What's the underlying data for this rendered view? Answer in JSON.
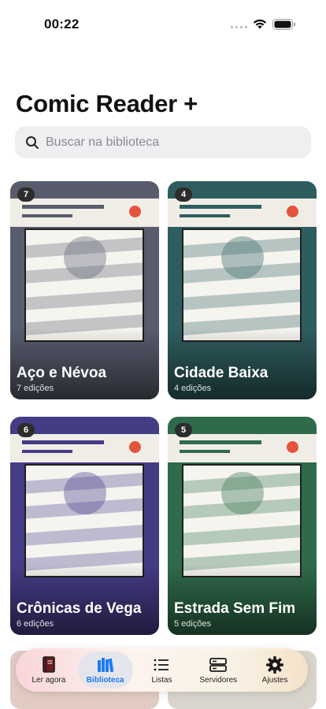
{
  "status_bar": {
    "time": "00:22"
  },
  "app": {
    "title": "Comic Reader +"
  },
  "search": {
    "placeholder": "Buscar na biblioteca"
  },
  "series": [
    {
      "title": "Aço e Névoa",
      "subtitle": "7 edições",
      "count": "7",
      "color": "#585c6d",
      "tint": "#676b7a"
    },
    {
      "title": "Cidade Baixa",
      "subtitle": "4 edições",
      "count": "4",
      "color": "#2f5d5f",
      "tint": "#3f6e70"
    },
    {
      "title": "Crônicas de Vega",
      "subtitle": "6 edições",
      "count": "6",
      "color": "#453c86",
      "tint": "#554c94"
    },
    {
      "title": "Estrada Sem Fim",
      "subtitle": "5 edições",
      "count": "5",
      "color": "#2f6b4a",
      "tint": "#3f7a58"
    }
  ],
  "tab_bar": {
    "tabs": [
      {
        "label": "Ler agora",
        "icon": "book-icon"
      },
      {
        "label": "Biblioteca",
        "icon": "library-icon",
        "active": true
      },
      {
        "label": "Listas",
        "icon": "list-icon"
      },
      {
        "label": "Servidores",
        "icon": "server-icon"
      },
      {
        "label": "Ajustes",
        "icon": "gear-icon"
      }
    ]
  },
  "colors": {
    "accent": "#1d7bf0",
    "badge": "#2c2c2c",
    "dot": "#e4543d"
  }
}
